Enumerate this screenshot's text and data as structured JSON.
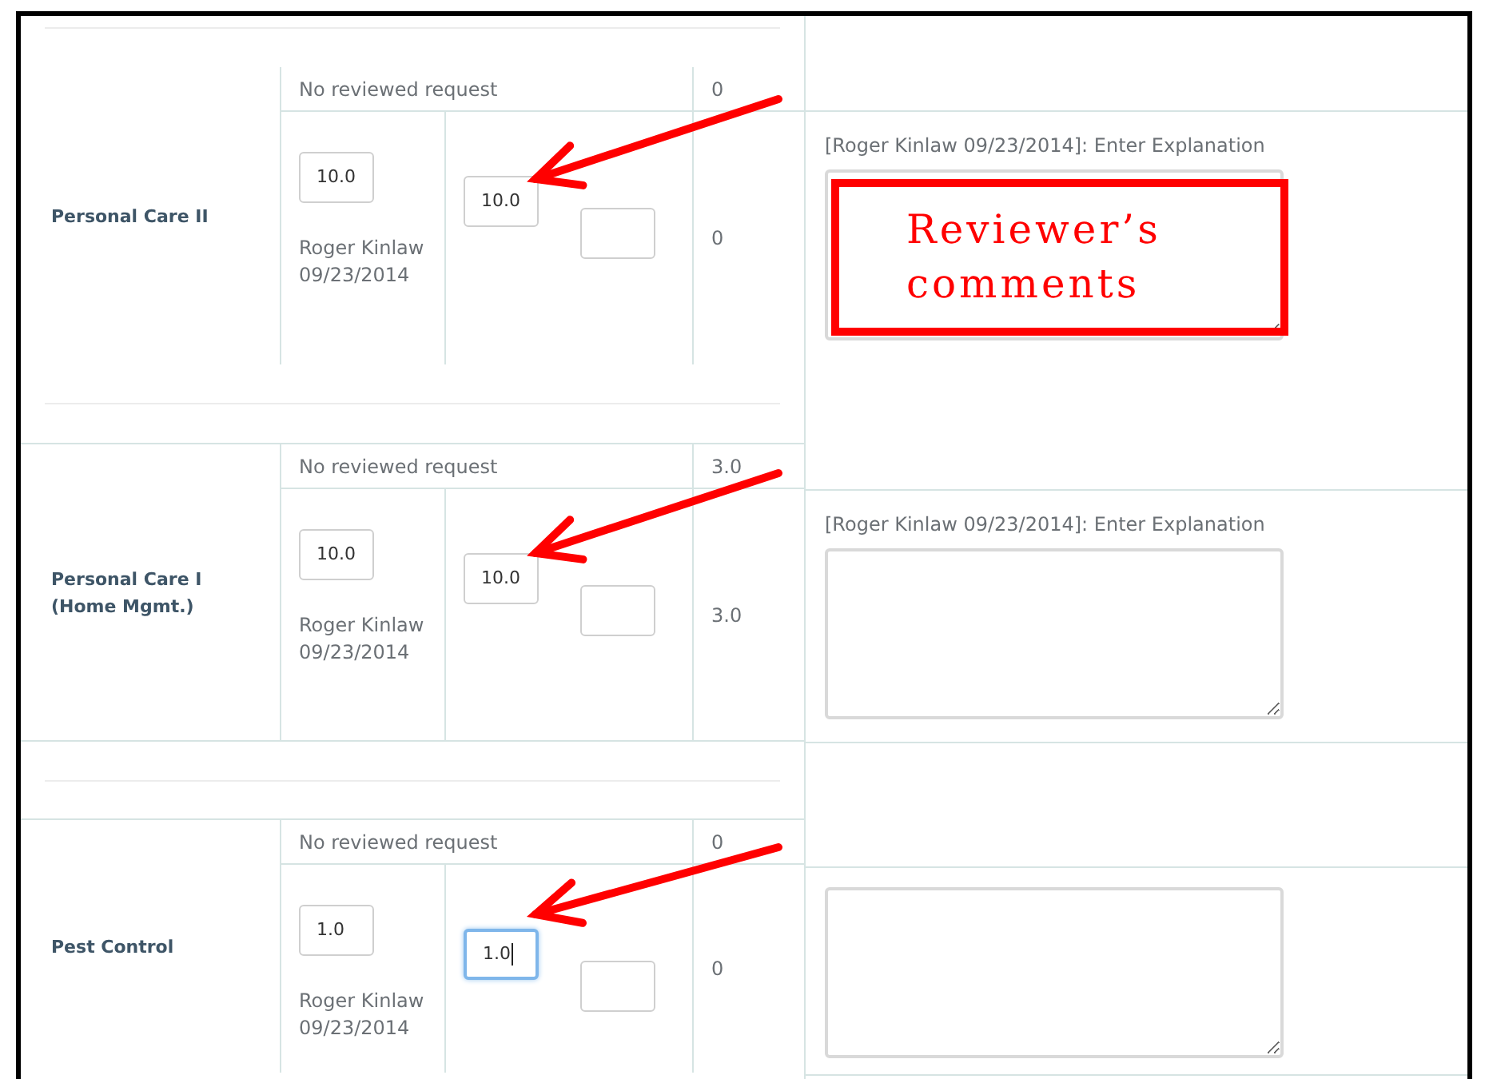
{
  "rows": [
    {
      "label": "Personal Care II",
      "request_note": "No reviewed request",
      "request_value": "0",
      "requested": "10.0",
      "requested_by": "Roger Kinlaw 09/23/2014",
      "approved": "10.0",
      "approved_focused": false,
      "total": "0",
      "explanation_label": "[Roger Kinlaw 09/23/2014]: Enter Explanation"
    },
    {
      "label": "Personal Care I (Home Mgmt.)",
      "request_note": "No reviewed request",
      "request_value": "3.0",
      "requested": "10.0",
      "requested_by": "Roger Kinlaw 09/23/2014",
      "approved": "10.0",
      "approved_focused": false,
      "total": "3.0",
      "explanation_label": "[Roger Kinlaw 09/23/2014]: Enter Explanation"
    },
    {
      "label": "Pest Control",
      "request_note": "No reviewed request",
      "request_value": "0",
      "requested": "1.0",
      "requested_by": "Roger Kinlaw 09/23/2014",
      "approved": "1.0",
      "approved_focused": true,
      "total": "0"
    }
  ],
  "callout": "Reviewer’s comments"
}
